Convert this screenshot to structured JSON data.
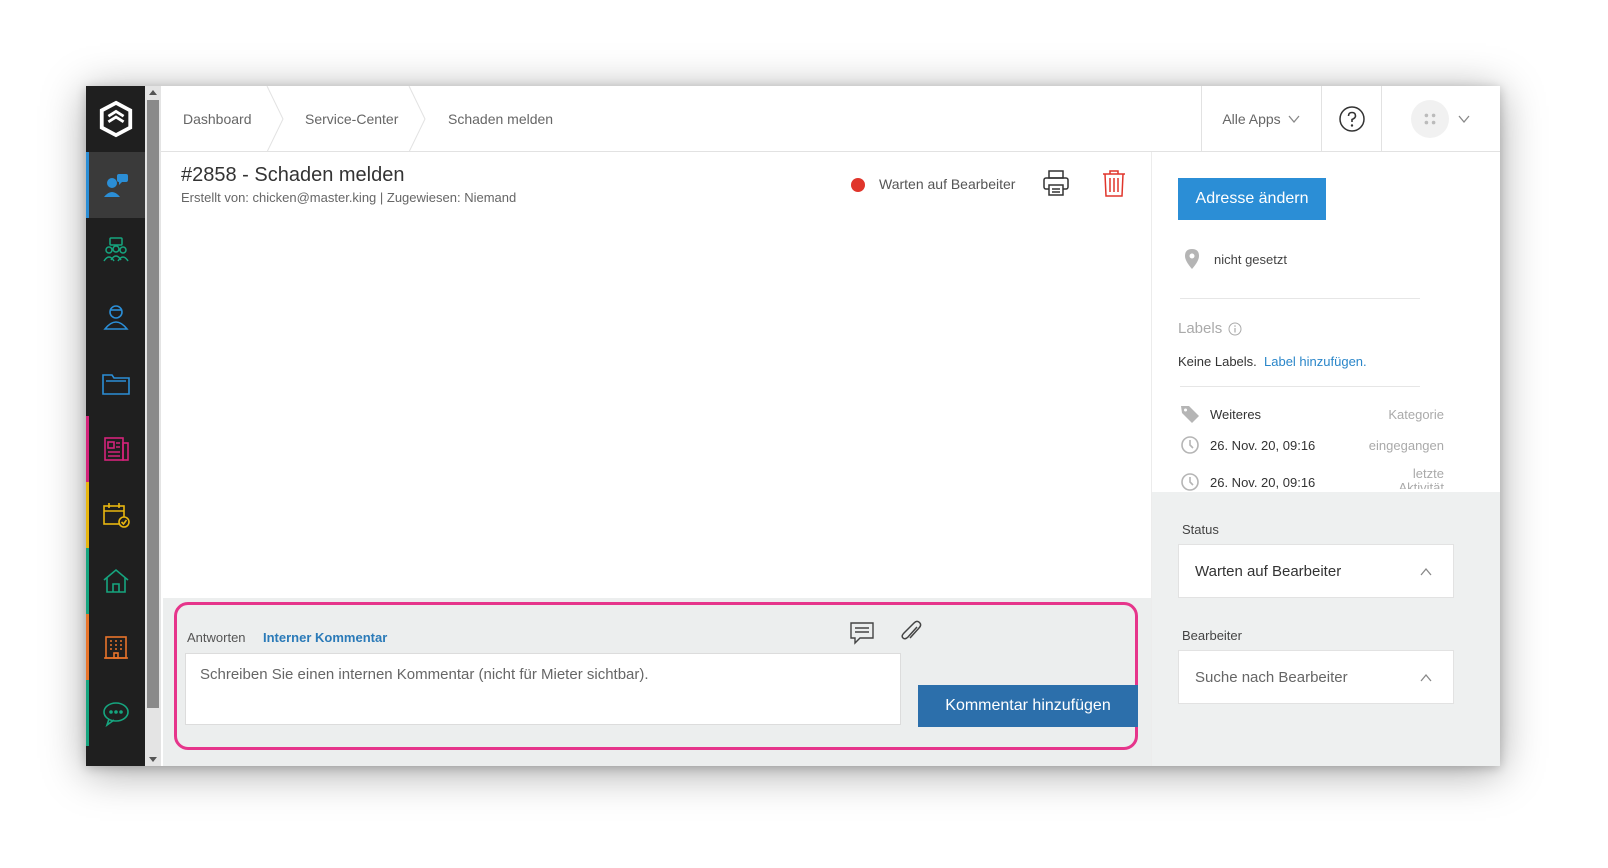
{
  "breadcrumbs": [
    "Dashboard",
    "Service-Center",
    "Schaden melden"
  ],
  "topbar": {
    "apps_label": "Alle Apps"
  },
  "ticket": {
    "title": "#2858 - Schaden melden",
    "meta": "Erstellt von: chicken@master.king | Zugewiesen: Niemand",
    "status": "Warten auf Bearbeiter"
  },
  "reply": {
    "tab_reply": "Antworten",
    "tab_internal": "Interner Kommentar",
    "placeholder": "Schreiben Sie einen internen Kommentar (nicht für Mieter sichtbar).",
    "submit_label": "Kommentar hinzufügen"
  },
  "side": {
    "address_button": "Adresse ändern",
    "address_value": "nicht gesetzt",
    "labels_title": "Labels",
    "no_labels": "Keine Labels.",
    "add_label": "Label hinzufügen.",
    "category_value": "Weiteres",
    "category_label": "Kategorie",
    "received_value": "26. Nov. 20, 09:16",
    "received_label": "eingegangen",
    "activity_value": "26. Nov. 20, 09:16",
    "activity_label": "letzte Aktivität",
    "status_label": "Status",
    "status_value": "Warten auf Bearbeiter",
    "assignee_label": "Bearbeiter",
    "assignee_placeholder": "Suche nach Bearbeiter"
  },
  "colors": {
    "accent_blue": "#2b8ed6",
    "button_dark_blue": "#2c6fab",
    "highlight_pink": "#e6358b",
    "status_red": "#e0352b",
    "rail_bg": "#1f1f1f"
  },
  "rail_icons": [
    "logo-icon",
    "service-center-icon",
    "community-icon",
    "tenant-icon",
    "folder-icon",
    "newspaper-icon",
    "calendar-check-icon",
    "home-icon",
    "building-icon",
    "chat-icon"
  ]
}
